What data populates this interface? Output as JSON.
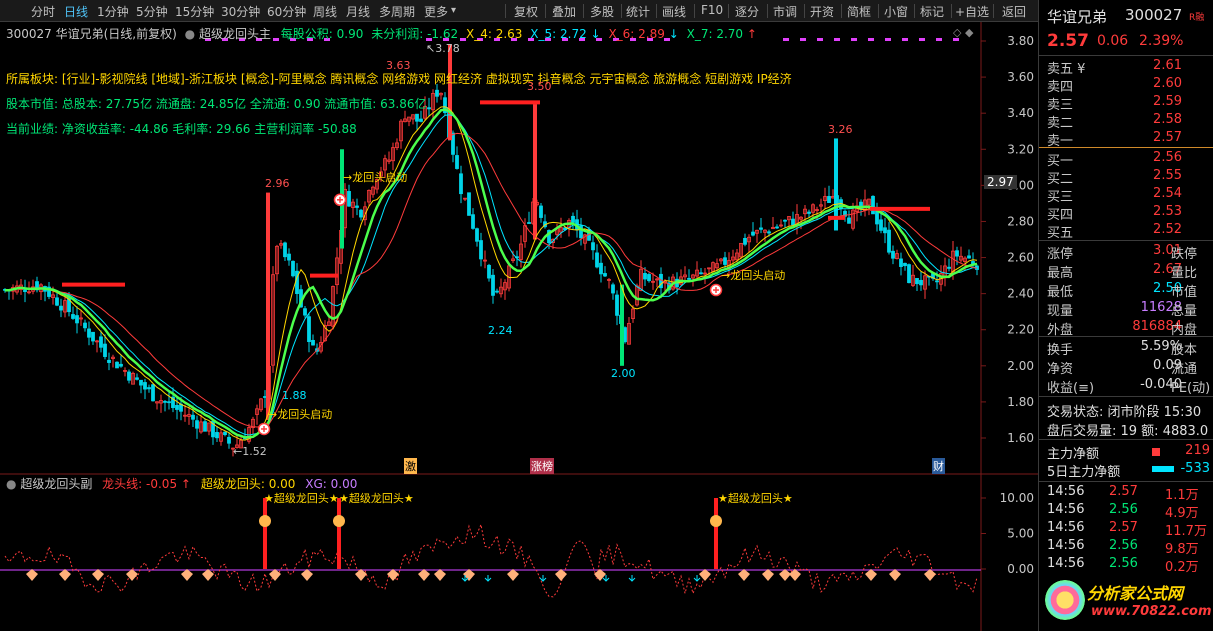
{
  "toolbar": {
    "items": [
      "分时",
      "日线",
      "1分钟",
      "5分钟",
      "15分钟",
      "30分钟",
      "60分钟",
      "周线",
      "月线",
      "多周期",
      "更多"
    ],
    "active_index": 1,
    "more_caret": "▾",
    "buttons": [
      "复权",
      "叠加",
      "多股",
      "统计",
      "画线",
      "F10",
      "逐分",
      "市调",
      "开资",
      "简框",
      "小窗",
      "标记",
      "+自选"
    ],
    "back": "返回"
  },
  "header_line": {
    "title": "300027 华谊兄弟(日线,前复权)",
    "indicator": "超级龙回头主",
    "mgsy_label": "每股公积:",
    "mgsy_value": "0.90",
    "wflr_label": "未分利润:",
    "wflr_value": "-1.62",
    "x4_label": "X_4:",
    "x4_value": "2.63",
    "x5_label": "X_5:",
    "x5_value": "2.72",
    "x5_arrow": "↓",
    "x6_label": "X_6:",
    "x6_value": "2.89",
    "x6_arrow": "↓",
    "x7_label": "X_7:",
    "x7_value": "2.70",
    "x7_arrow": "↑"
  },
  "info": {
    "sector_line": "所属板块: [行业]-影视院线 [地域]-浙江板块 [概念]-阿里概念 腾讯概念 网络游戏 网红经济 虚拟现实 抖音概念 元宇宙概念 旅游概念 短剧游戏 IP经济",
    "capital_line": "股本市值: 总股本: 27.75亿 流通盘: 24.85亿 全流通: 0.90 流通市值: 63.86亿",
    "perf_line": "当前业绩: 净资收益率: -44.86 毛利率: 29.66 主营利润率 -50.88"
  },
  "price_axis": [
    "3.80",
    "3.60",
    "3.40",
    "3.20",
    "3.00",
    "2.80",
    "2.60",
    "2.40",
    "2.20",
    "2.00",
    "1.80",
    "1.60"
  ],
  "current_price_tag": "2.97",
  "annotations": {
    "hi_378": "3.78",
    "hi_363": "3.63",
    "hi_350": "3.50",
    "hi_326": "3.26",
    "hi_296": "2.96",
    "lo_224": "2.24",
    "lo_200": "2.00",
    "lo_188": "1.88",
    "lo_152": "1.52",
    "signal": "→龙回头启动",
    "arrow_left": "←",
    "arrow_up_left": "↖"
  },
  "markers": {
    "ji": "激",
    "zhangbang": "涨榜",
    "cai": "财"
  },
  "sub_header": {
    "name": "超级龙回头副",
    "ltx_label": "龙头线:",
    "ltx_value": "-0.05",
    "ltx_arrow": "↑",
    "cjlht_label": "超级龙回头:",
    "cjlht_value": "0.00",
    "xg_label": "XG:",
    "xg_value": "0.00",
    "star_label": "★超级龙回头★"
  },
  "sub_axis": [
    "10.00",
    "5.00",
    "0.00"
  ],
  "panel": {
    "stock_name": "华谊兄弟",
    "stock_code": "300027",
    "rzrq": "R融",
    "price": "2.57",
    "change": "0.06",
    "change_pct": "2.39%",
    "asks": [
      {
        "label": "卖五",
        "price": "2.61",
        "mark": "¥"
      },
      {
        "label": "卖四",
        "price": "2.60"
      },
      {
        "label": "卖三",
        "price": "2.59"
      },
      {
        "label": "卖二",
        "price": "2.58"
      },
      {
        "label": "卖一",
        "price": "2.57"
      }
    ],
    "bids": [
      {
        "label": "买一",
        "price": "2.56"
      },
      {
        "label": "买二",
        "price": "2.55"
      },
      {
        "label": "买三",
        "price": "2.54"
      },
      {
        "label": "买四",
        "price": "2.53"
      },
      {
        "label": "买五",
        "price": "2.52"
      }
    ],
    "stats": [
      {
        "k": "涨停",
        "v": "3.01",
        "k2": "跌停"
      },
      {
        "k": "最高",
        "v": "2.67",
        "k2": "量比"
      },
      {
        "k": "最低",
        "v": "2.50",
        "k2": "市值"
      },
      {
        "k": "现量",
        "v": "11628",
        "k2": "总量"
      },
      {
        "k": "外盘",
        "v": "816884",
        "k2": "内盘"
      }
    ],
    "stats2": [
      {
        "k": "换手",
        "v": "5.59%",
        "k2": "股本"
      },
      {
        "k": "净资",
        "v": "0.09",
        "k2": "流通"
      },
      {
        "k": "收益(≡)",
        "v": "-0.040",
        "k2": "PE(动)"
      }
    ],
    "trade_state": "交易状态: 闭市阶段 15:30",
    "after_hours": "盘后交易量: 19  额: 4883.0",
    "main_net_label": "主力净额",
    "main_net_value": "219",
    "main5_label": "5日主力净额",
    "main5_value": "-533",
    "ticks": [
      {
        "t": "14:56",
        "p": "2.57",
        "v": "1.1万"
      },
      {
        "t": "14:56",
        "p": "2.56",
        "v": "4.9万"
      },
      {
        "t": "14:56",
        "p": "2.57",
        "v": "11.7万"
      },
      {
        "t": "14:56",
        "p": "2.56",
        "v": "9.8万"
      },
      {
        "t": "14:56",
        "p": "2.56",
        "v": "0.2万"
      }
    ],
    "watermark_cn": "分析家公式网",
    "watermark_url": "www.70822.com"
  },
  "chart_data": {
    "type": "candlestick",
    "title": "300027 华谊兄弟(日线,前复权)",
    "y_range": [
      1.5,
      3.85
    ],
    "labeled_extremes": [
      {
        "label": "3.78",
        "value": 3.78
      },
      {
        "label": "3.63",
        "value": 3.63
      },
      {
        "label": "3.50",
        "value": 3.5
      },
      {
        "label": "3.26",
        "value": 3.26
      },
      {
        "label": "2.96",
        "value": 2.96
      },
      {
        "label": "2.24",
        "value": 2.24
      },
      {
        "label": "2.00",
        "value": 2.0
      },
      {
        "label": "1.88",
        "value": 1.88
      },
      {
        "label": "1.52",
        "value": 1.52
      }
    ]
  }
}
